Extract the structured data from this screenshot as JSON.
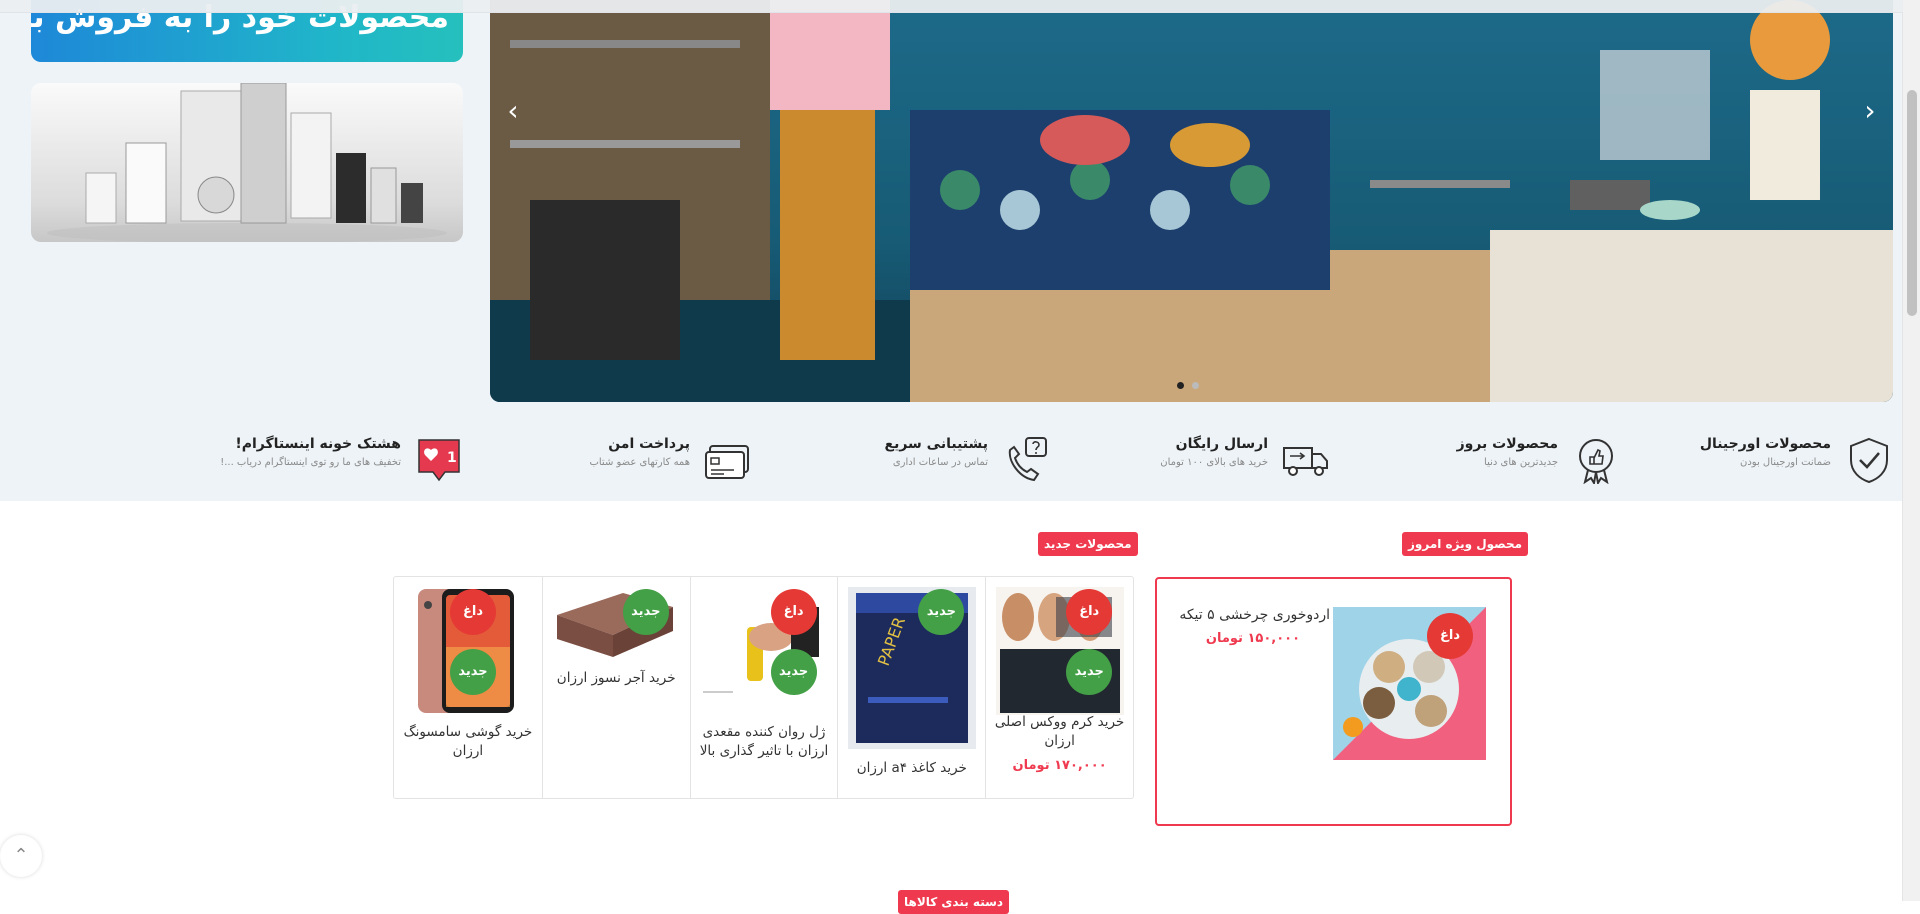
{
  "promo": {
    "teal_text": "محصولات خود را به فروش برسانید"
  },
  "hero": {
    "prev_icon": "chevron-left-icon",
    "next_icon": "chevron-right-icon",
    "slide_count": 2,
    "active_slide": 1
  },
  "features": [
    {
      "title": "محصولات اورجینال",
      "subtitle": "ضمانت اورجینال بودن",
      "icon": "shield-check-icon"
    },
    {
      "title": "محصولات بروز",
      "subtitle": "جدیدترین های دنیا",
      "icon": "thumbs-up-medal-icon"
    },
    {
      "title": "ارسال رایگان",
      "subtitle": "خرید های بالای ۱۰۰ تومان",
      "icon": "truck-icon"
    },
    {
      "title": "پشتیبانی سریع",
      "subtitle": "تماس در ساعات اداری",
      "icon": "phone-question-icon"
    },
    {
      "title": "پرداخت امن",
      "subtitle": "همه کارتهای عضو شتاب",
      "icon": "credit-card-icon"
    },
    {
      "title": "هشتک خونه اینستاگرام!",
      "subtitle": "تخفیف های ما رو توی اینستاگرام دریاب ...!",
      "icon": "heart-notification-icon",
      "count": "1"
    }
  ],
  "special": {
    "tag": "محصول ویژه امروز",
    "badge": "داغ",
    "name": "اردوخوری چرخشی ۵ تیکه",
    "price": "۱۵۰,۰۰۰ تومان"
  },
  "new_products": {
    "tag": "محصولات جدید",
    "hot_label": "داغ",
    "new_label": "جدید",
    "items": [
      {
        "name": "خرید کرم ووکس اصلی ارزان",
        "price": "۱۷۰,۰۰۰ تومان"
      },
      {
        "name": "خرید کاغذ a۴ ارزان",
        "price": ""
      },
      {
        "name": "ژل روان کننده مقعدی ارزان با تاثیر گذاری بالا",
        "price": ""
      },
      {
        "name": "خرید آجر نسوز ارزان",
        "price": ""
      },
      {
        "name": "خرید گوشی سامسونگ ارزان",
        "price": ""
      }
    ]
  },
  "next_section_tag": "دسته بندی کالاها",
  "colors": {
    "accent": "#ef394e",
    "new_green": "#43a047",
    "hot_red": "#e53935",
    "band": "#eef3f7"
  }
}
